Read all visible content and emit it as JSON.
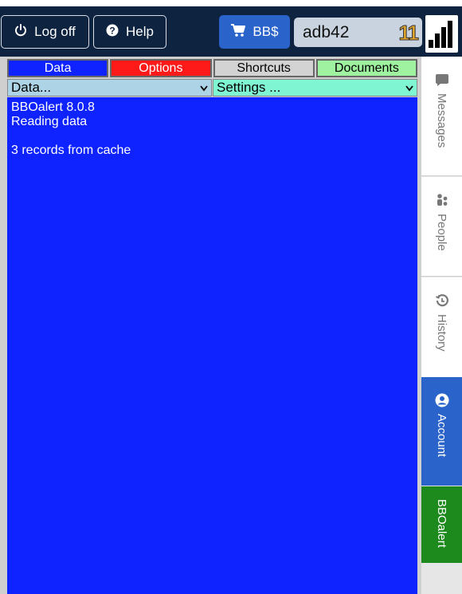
{
  "topbar": {
    "logoff_label": "Log off",
    "help_label": "Help",
    "bbs_label": "BB$",
    "username": "adb42",
    "user_count": "11"
  },
  "tabs": [
    {
      "label": "Data",
      "color": "#0e23ff"
    },
    {
      "label": "Options",
      "color": "#ff1a1a"
    },
    {
      "label": "Shortcuts",
      "color": "#d3d3d3"
    },
    {
      "label": "Documents",
      "color": "#9ff29f"
    }
  ],
  "selects": {
    "data_value": "Data...",
    "settings_value": "Settings ..."
  },
  "log": {
    "lines": [
      "BBOalert 8.0.8",
      "Reading data",
      "",
      "3 records from cache"
    ]
  },
  "sidebar": {
    "items": [
      {
        "label": "Messages",
        "icon": "message-icon"
      },
      {
        "label": "People",
        "icon": "people-icon"
      },
      {
        "label": "History",
        "icon": "history-icon"
      },
      {
        "label": "Account",
        "icon": "account-icon"
      },
      {
        "label": "BBOalert",
        "icon": ""
      }
    ]
  },
  "colors": {
    "topbar_bg": "#0d2340",
    "accent_blue": "#2a63c9",
    "log_bg": "#0e23ff",
    "bboalert_green": "#1d8a1d"
  }
}
